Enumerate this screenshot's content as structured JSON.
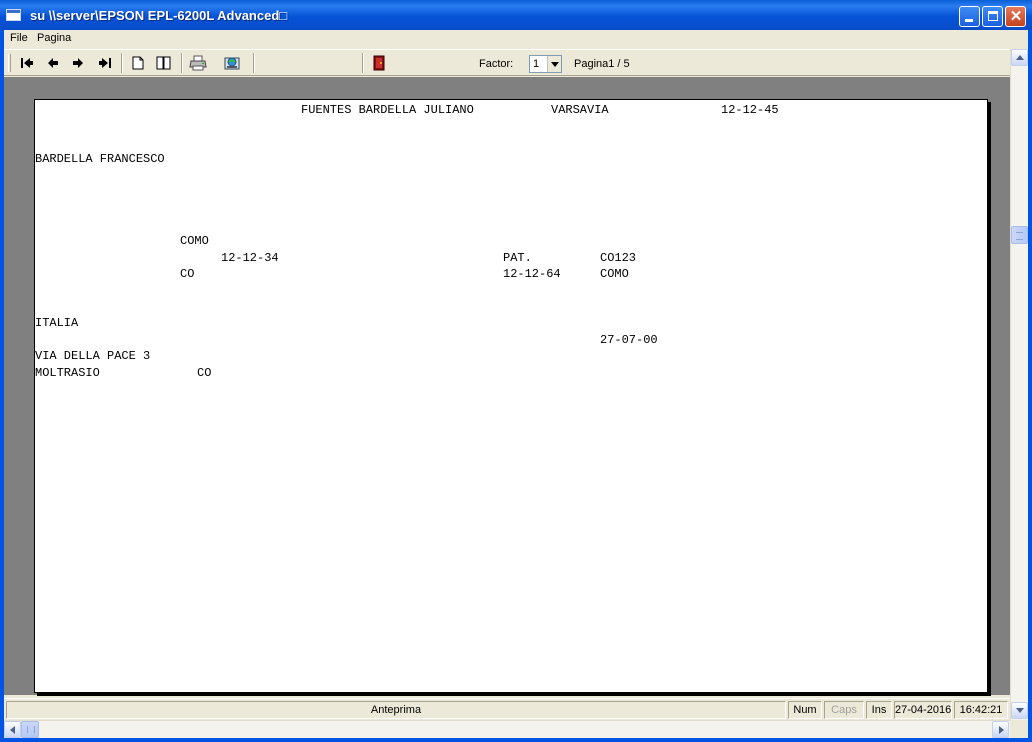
{
  "window": {
    "title": "su \\\\server\\EPSON EPL-6200L Advanced□"
  },
  "menu": {
    "items": [
      "File",
      "Pagina"
    ]
  },
  "toolbar": {
    "buttons": [
      "first-page-icon",
      "previous-page-icon",
      "next-page-icon",
      "last-page-icon",
      "single-page-icon",
      "two-pages-icon",
      "printer-icon",
      "export-icon",
      "exit-door-icon"
    ],
    "factor_label": "Factor:",
    "factor_value": "1",
    "page_indicator": "Pagina1 / 5"
  },
  "document": {
    "header_name": "FUENTES BARDELLA JULIANO",
    "header_city": "VARSAVIA",
    "header_date": "12-12-45",
    "father_name": "BARDELLA FRANCESCO",
    "birth_city": "COMO",
    "birth_date": "12-12-34",
    "province": "CO",
    "pat_label": "PAT.",
    "pat_code": "CO123",
    "issue_date": "12-12-64",
    "issue_city": "COMO",
    "country": "ITALIA",
    "expiry_date": "27-07-00",
    "address": "VIA DELLA PACE 3",
    "town": "MOLTRASIO",
    "town_province": "CO"
  },
  "status": {
    "mode": "Anteprima",
    "num": "Num",
    "caps": "Caps",
    "ins": "Ins",
    "date": "27-04-2016",
    "time": "16:42:21"
  }
}
